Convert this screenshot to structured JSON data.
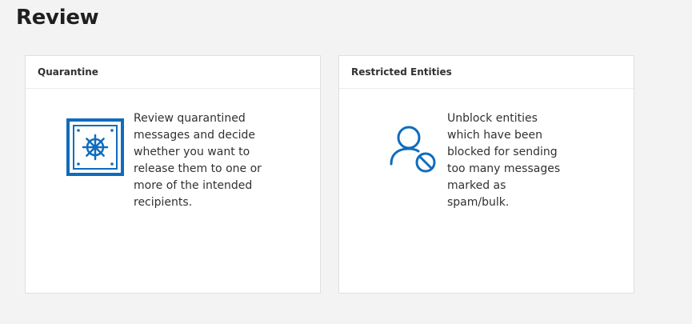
{
  "page": {
    "title": "Review"
  },
  "cards": [
    {
      "title": "Quarantine",
      "icon": "vault-icon",
      "description": "Review quarantined messages and decide whether you want to release them to one or more of the intended recipients."
    },
    {
      "title": "Restricted Entities",
      "icon": "blocked-user-icon",
      "description": "Unblock entities which have been blocked for sending too many messages marked as spam/bulk."
    }
  ],
  "colors": {
    "accent": "#0f6cbd",
    "background": "#f3f3f3",
    "card": "#ffffff"
  }
}
